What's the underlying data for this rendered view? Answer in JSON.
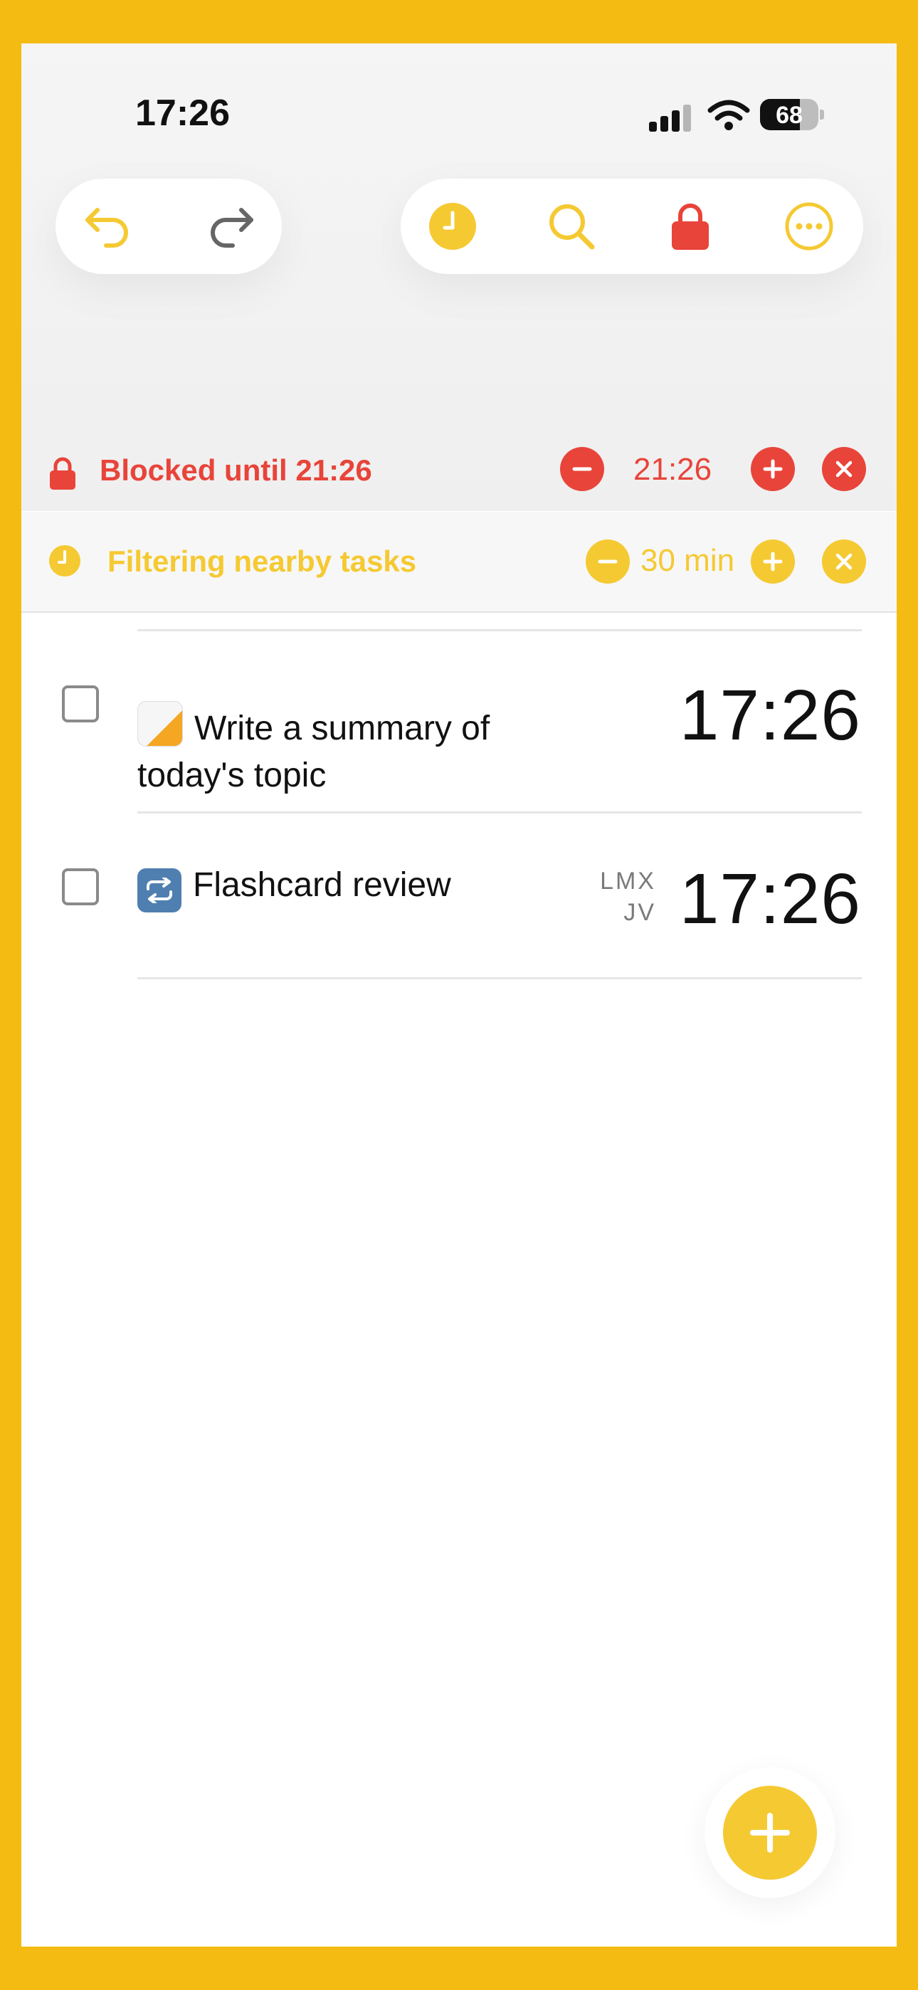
{
  "status_bar": {
    "time": "17:26",
    "battery_level": "68"
  },
  "toolbar": {
    "left": [
      {
        "name": "undo-icon"
      },
      {
        "name": "redo-icon"
      }
    ],
    "right": [
      {
        "name": "clock-icon"
      },
      {
        "name": "search-icon"
      },
      {
        "name": "lock-icon"
      },
      {
        "name": "more-icon"
      }
    ]
  },
  "blocked_banner": {
    "label": "Blocked until 21:26",
    "value": "21:26",
    "color": "#E8443A"
  },
  "filter_banner": {
    "label": "Filtering nearby tasks",
    "value": "30 min",
    "color": "#F5C932"
  },
  "tasks": [
    {
      "emoji_icon": "memo-icon",
      "title_line1": "Write a summary of",
      "title_line2": "today's topic",
      "time": "17:26",
      "checked": false
    },
    {
      "emoji_icon": "repeat-icon",
      "title_line1": "Flashcard review",
      "repeat_days_line1": "LMX",
      "repeat_days_line2": "JV",
      "time": "17:26",
      "checked": false
    }
  ],
  "fab": {
    "icon": "plus-icon"
  }
}
